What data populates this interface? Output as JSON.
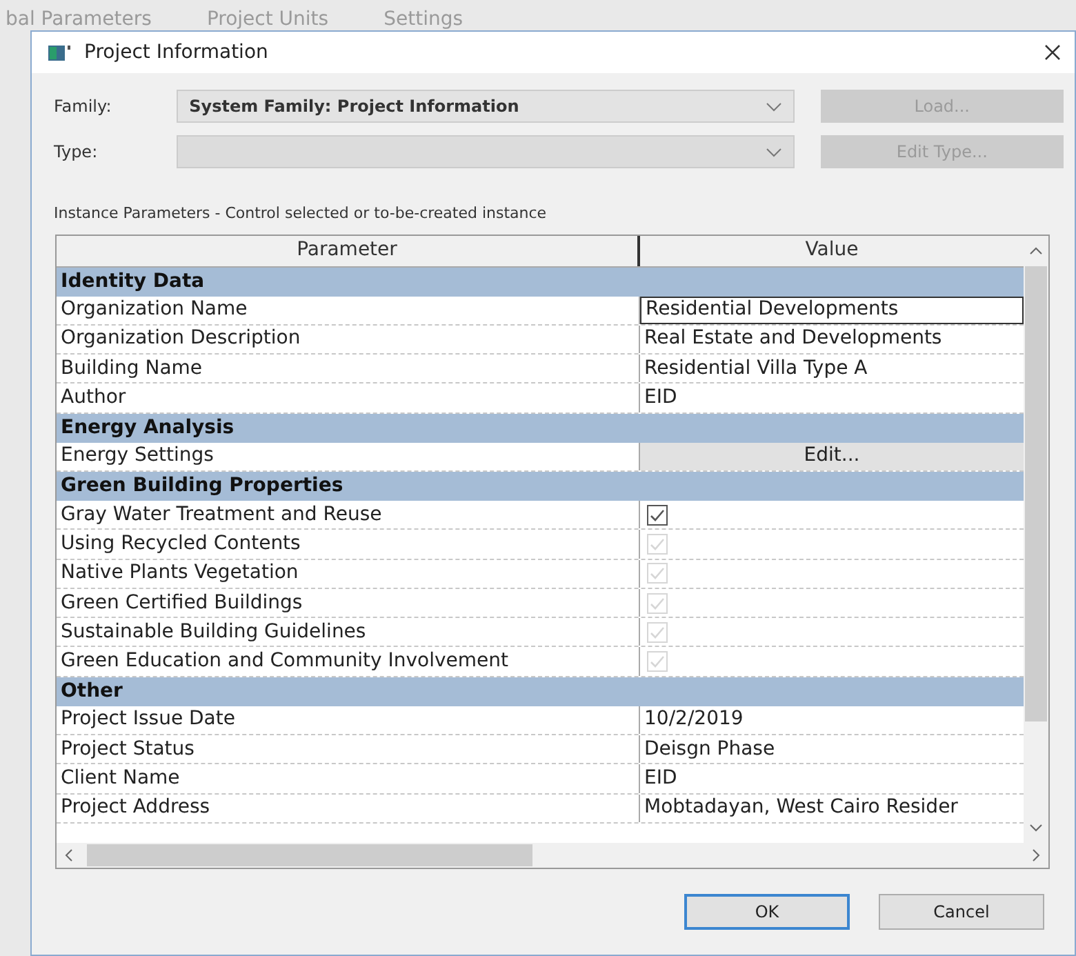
{
  "background_ribbon": [
    "bal Parameters",
    "Project Units",
    "Settings"
  ],
  "window": {
    "title": "Project Information"
  },
  "family": {
    "label": "Family:",
    "value": "System Family: Project Information",
    "disabled": false
  },
  "type": {
    "label": "Type:",
    "disabled": true
  },
  "buttons_side": [
    {
      "label": "Load...",
      "disabled": true
    },
    {
      "label": "Edit Type...",
      "disabled": true
    }
  ],
  "instance_label": "Instance Parameters - Control selected or to-be-created instance",
  "table": {
    "columns": [
      "Parameter",
      "Value"
    ],
    "groups": [
      {
        "title": "Identity Data",
        "rows": [
          {
            "kind": "text",
            "name": "Organization Name",
            "value": "Residential Developments",
            "selected": true
          },
          {
            "kind": "text",
            "name": "Organization Description",
            "value": "Real Estate and Developments",
            "selected": false
          },
          {
            "kind": "text",
            "name": "Building Name",
            "value": "Residential Villa Type A",
            "selected": false
          },
          {
            "kind": "text",
            "name": "Author",
            "value": "EID",
            "selected": false
          }
        ]
      },
      {
        "title": "Energy Analysis",
        "rows": [
          {
            "kind": "button",
            "name": "Energy Settings",
            "value": "Edit...",
            "selected": false
          }
        ]
      },
      {
        "title": "Green Building Properties",
        "rows": [
          {
            "kind": "checkbox",
            "name": "Gray Water Treatment and Reuse",
            "checked": true,
            "disabled": false,
            "selected": false
          },
          {
            "kind": "checkbox",
            "name": "Using Recycled Contents",
            "checked": true,
            "disabled": true,
            "selected": false
          },
          {
            "kind": "checkbox",
            "name": "Native Plants Vegetation",
            "checked": true,
            "disabled": true,
            "selected": false
          },
          {
            "kind": "checkbox",
            "name": "Green Certified Buildings",
            "checked": true,
            "disabled": true,
            "selected": false
          },
          {
            "kind": "checkbox",
            "name": "Sustainable Building Guidelines",
            "checked": true,
            "disabled": true,
            "selected": false
          },
          {
            "kind": "checkbox",
            "name": "Green Education and Community Involvement",
            "checked": true,
            "disabled": true,
            "selected": false
          }
        ]
      },
      {
        "title": "Other",
        "rows": [
          {
            "kind": "text",
            "name": "Project Issue Date",
            "value": "10/2/2019",
            "selected": false
          },
          {
            "kind": "text",
            "name": "Project Status",
            "value": "Deisgn Phase",
            "selected": false
          },
          {
            "kind": "text",
            "name": "Client Name",
            "value": "EID",
            "selected": false
          },
          {
            "kind": "text",
            "name": "Project Address",
            "value": "Mobtadayan, West Cairo Resider",
            "selected": false
          }
        ]
      }
    ]
  },
  "buttons": [
    {
      "label": "OK",
      "default": true
    },
    {
      "label": "Cancel",
      "default": false
    }
  ]
}
